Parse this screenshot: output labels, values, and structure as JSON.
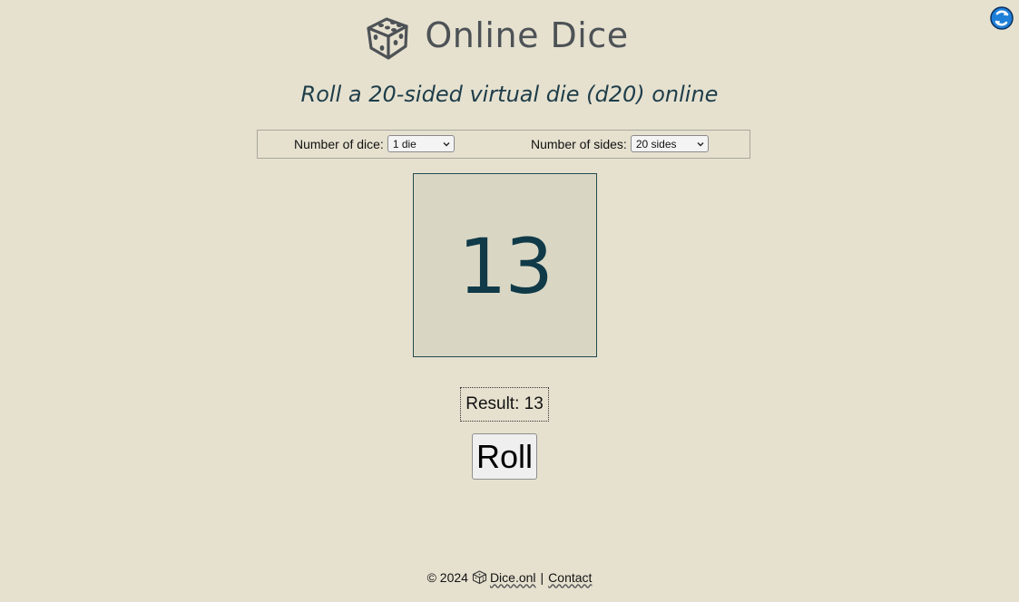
{
  "header": {
    "title": "Online Dice",
    "logo_icon": "dice-icon",
    "corner_icon": "refresh-icon"
  },
  "subtitle": "Roll a 20-sided virtual die (d20) online",
  "controls": {
    "dice_label": "Number of dice:",
    "dice_value": "1 die",
    "sides_label": "Number of sides:",
    "sides_value": "20 sides"
  },
  "die": {
    "value": "13"
  },
  "result": {
    "text": "Result: 13"
  },
  "roll_button": {
    "label": "Roll"
  },
  "footer": {
    "copyright": "© 2024",
    "site_link": "Dice.onl",
    "separator": "|",
    "contact_link": "Contact"
  },
  "colors": {
    "background": "#e6e1cf",
    "die_background": "#d9d7c4",
    "die_text": "#103a48",
    "subtitle": "#1e3d4a",
    "title": "#4d5256",
    "corner_icon": "#1e7fd8"
  }
}
